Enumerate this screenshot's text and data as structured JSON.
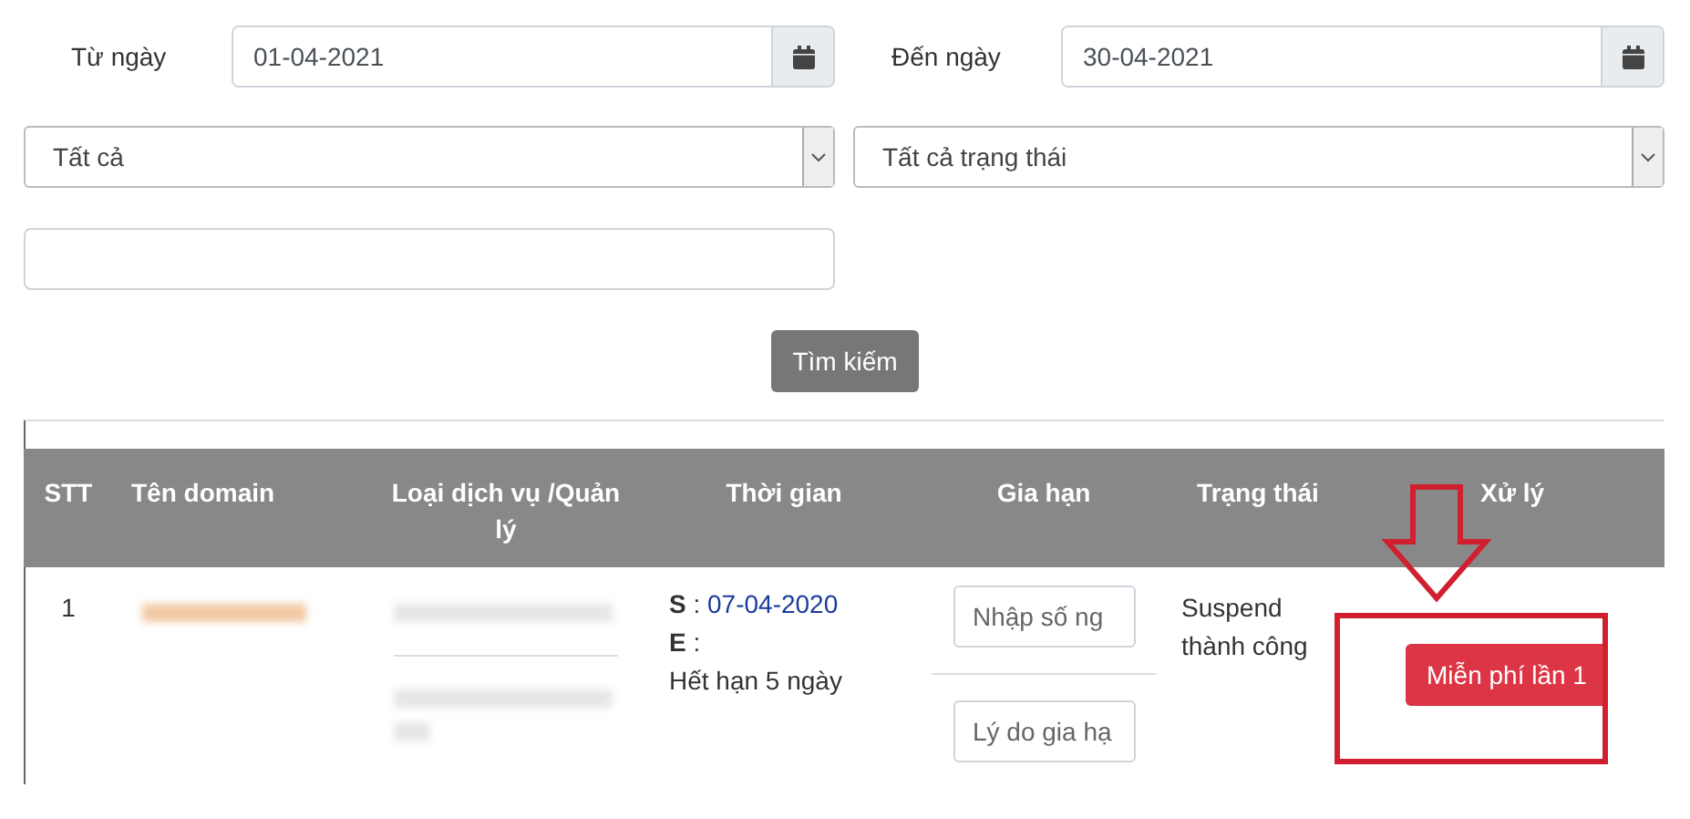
{
  "filters": {
    "from_label": "Từ ngày",
    "from_value": "01-04-2021",
    "to_label": "Đến ngày",
    "to_value": "30-04-2021",
    "type_select": "Tất cả",
    "status_select": "Tất cả trạng thái",
    "search_button": "Tìm kiếm"
  },
  "table": {
    "columns": [
      "STT",
      "Tên domain",
      "Loại dịch vụ /Quản lý",
      "Thời gian",
      "Gia hạn",
      "Trạng thái",
      "Xử lý"
    ],
    "rows": [
      {
        "stt": "1",
        "start_label": "S",
        "start_sep": ":",
        "start_date": "07-04-2020",
        "end_label": "E",
        "end_sep": ":",
        "remaining": "Hết hạn 5 ngày",
        "days_placeholder": "Nhập số ng",
        "reason_placeholder": "Lý do gia hạ",
        "status": "Suspend thành công",
        "action": "Miễn phí lần 1"
      }
    ]
  }
}
